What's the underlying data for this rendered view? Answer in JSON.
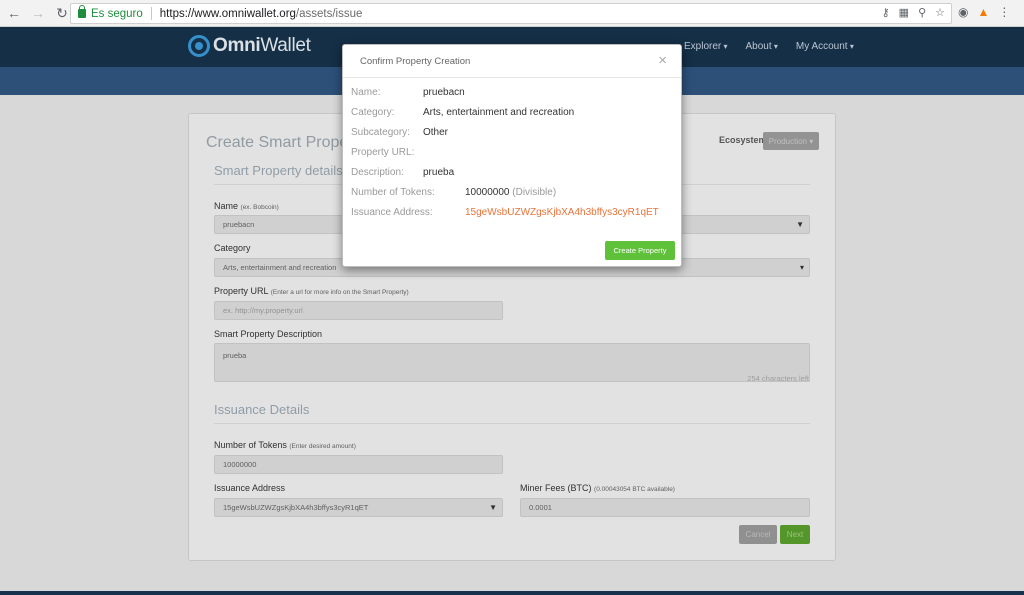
{
  "browser": {
    "secure_label": "Es seguro",
    "url_host": "https://www.omniwallet.org",
    "url_path": "/assets/issue"
  },
  "header": {
    "brand_a": "Omni",
    "brand_b": "Wallet",
    "nav": [
      "Explorer",
      "About",
      "My Account"
    ]
  },
  "form": {
    "title": "Create Smart Property",
    "ecosystem_label": "Ecosystem",
    "ecosystem_value": "Production",
    "details_title": "Smart Property details",
    "name_label": "Name",
    "name_hint": "(ex. Bobcoin)",
    "name_value": "pruebacn",
    "category_label": "Category",
    "category_value": "Arts, entertainment and recreation",
    "url_label": "Property URL",
    "url_hint": "(Enter a url for more info on the Smart Property)",
    "url_placeholder": "ex. http://my.property.url",
    "desc_label": "Smart Property Description",
    "desc_value": "prueba",
    "desc_count": "254 characters left",
    "issuance_title": "Issuance Details",
    "tokens_label": "Number of Tokens",
    "tokens_hint": "(Enter desired amount)",
    "tokens_value": "10000000",
    "address_label": "Issuance Address",
    "address_value": "15geWsbUZWZgsKjbXA4h3bffys3cyR1qET",
    "fees_label": "Miner Fees (BTC)",
    "fees_hint": "(0.00043054 BTC available)",
    "fees_value": "0.0001",
    "cancel_label": "Cancel",
    "next_label": "Next"
  },
  "modal": {
    "title": "Confirm Property Creation",
    "close": "×",
    "name_k": "Name:",
    "name_v": "pruebacn",
    "category_k": "Category:",
    "category_v": "Arts, entertainment and recreation",
    "subcategory_k": "Subcategory:",
    "subcategory_v": "Other",
    "url_k": "Property URL:",
    "url_v": "",
    "desc_k": "Description:",
    "desc_v": "prueba",
    "tokens_k": "Number of Tokens:",
    "tokens_v": "10000000",
    "tokens_suffix": "(Divisible)",
    "address_k": "Issuance Address:",
    "address_v": "15geWsbUZWZgsKjbXA4h3bffys3cyR1qET",
    "create_label": "Create Property"
  },
  "colors": {
    "navbar": "#17324c",
    "subbar": "#2f5680",
    "accent_green": "#5fc13a",
    "address_orange": "#e8743b"
  }
}
